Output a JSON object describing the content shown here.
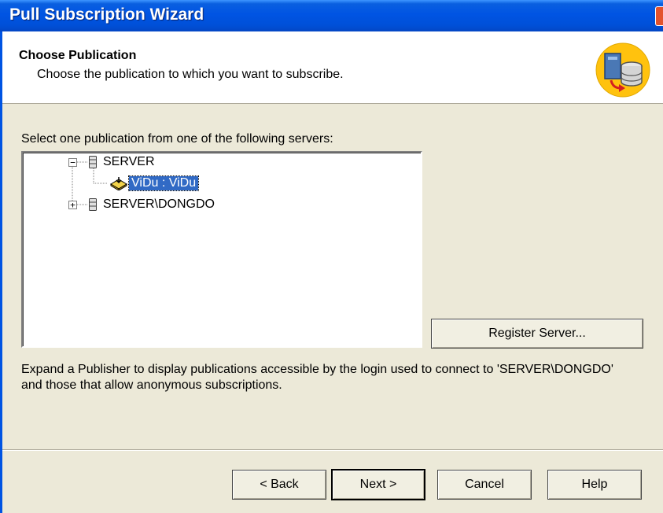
{
  "window": {
    "title": "Pull Subscription Wizard"
  },
  "header": {
    "title": "Choose Publication",
    "subtitle": "Choose the publication to which you want to subscribe."
  },
  "main": {
    "group_label": "Select one publication from one of the following servers:",
    "tree": [
      {
        "label": "SERVER",
        "expanded": true,
        "icon": "server-icon"
      },
      {
        "label": "ViDu : ViDu",
        "selected": true,
        "icon": "publication-icon"
      },
      {
        "label": "SERVER\\DONGDO",
        "expanded": false,
        "icon": "server-icon"
      }
    ],
    "register_server_label": "Register Server...",
    "description": "Expand a Publisher to display publications accessible by the login used to connect to 'SERVER\\DONGDO' and those that allow anonymous subscriptions."
  },
  "footer": {
    "back_label": "< Back",
    "next_label": "Next >",
    "cancel_label": "Cancel",
    "help_label": "Help"
  },
  "colors": {
    "titlebar": "#0054e3",
    "dialog_bg": "#ece9d8",
    "selection": "#316ac5"
  }
}
